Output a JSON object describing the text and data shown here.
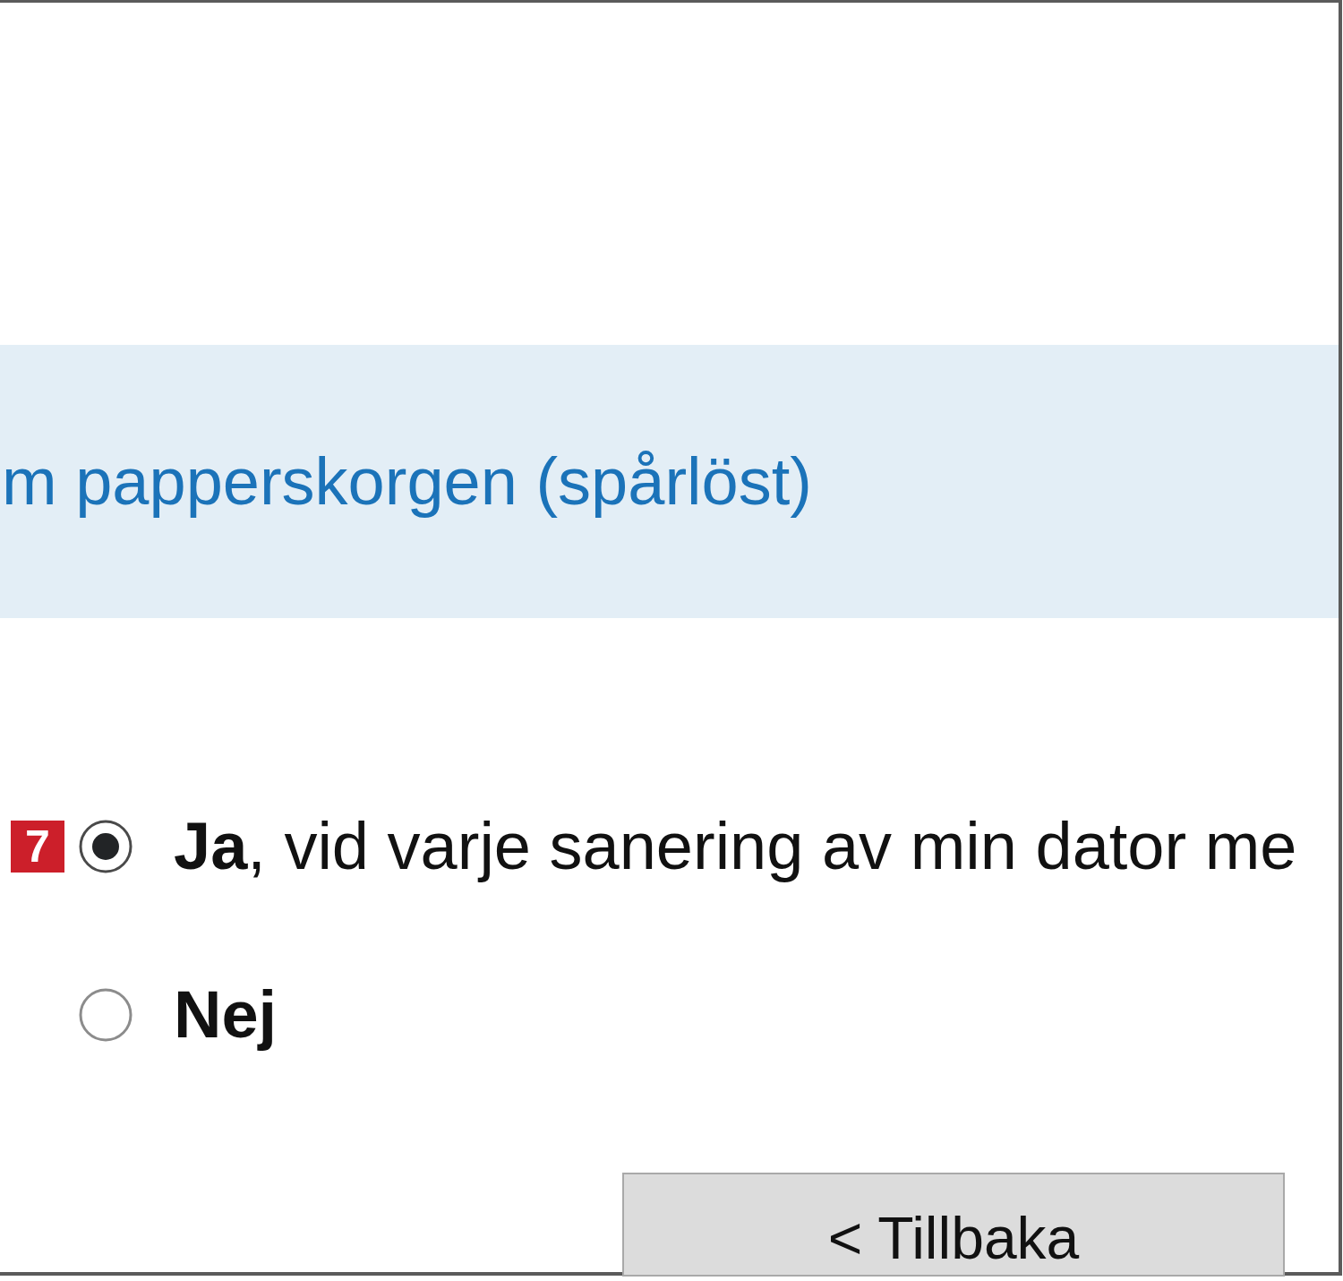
{
  "heading": {
    "text": "m papperskorgen (spårlöst)"
  },
  "options": [
    {
      "badge": "7",
      "answer": "Ja",
      "detail": ", vid varje sanering av min dator me",
      "selected": true
    },
    {
      "answer": "Nej",
      "selected": false
    }
  ],
  "buttons": [
    {
      "label": "< Tillbaka"
    }
  ]
}
